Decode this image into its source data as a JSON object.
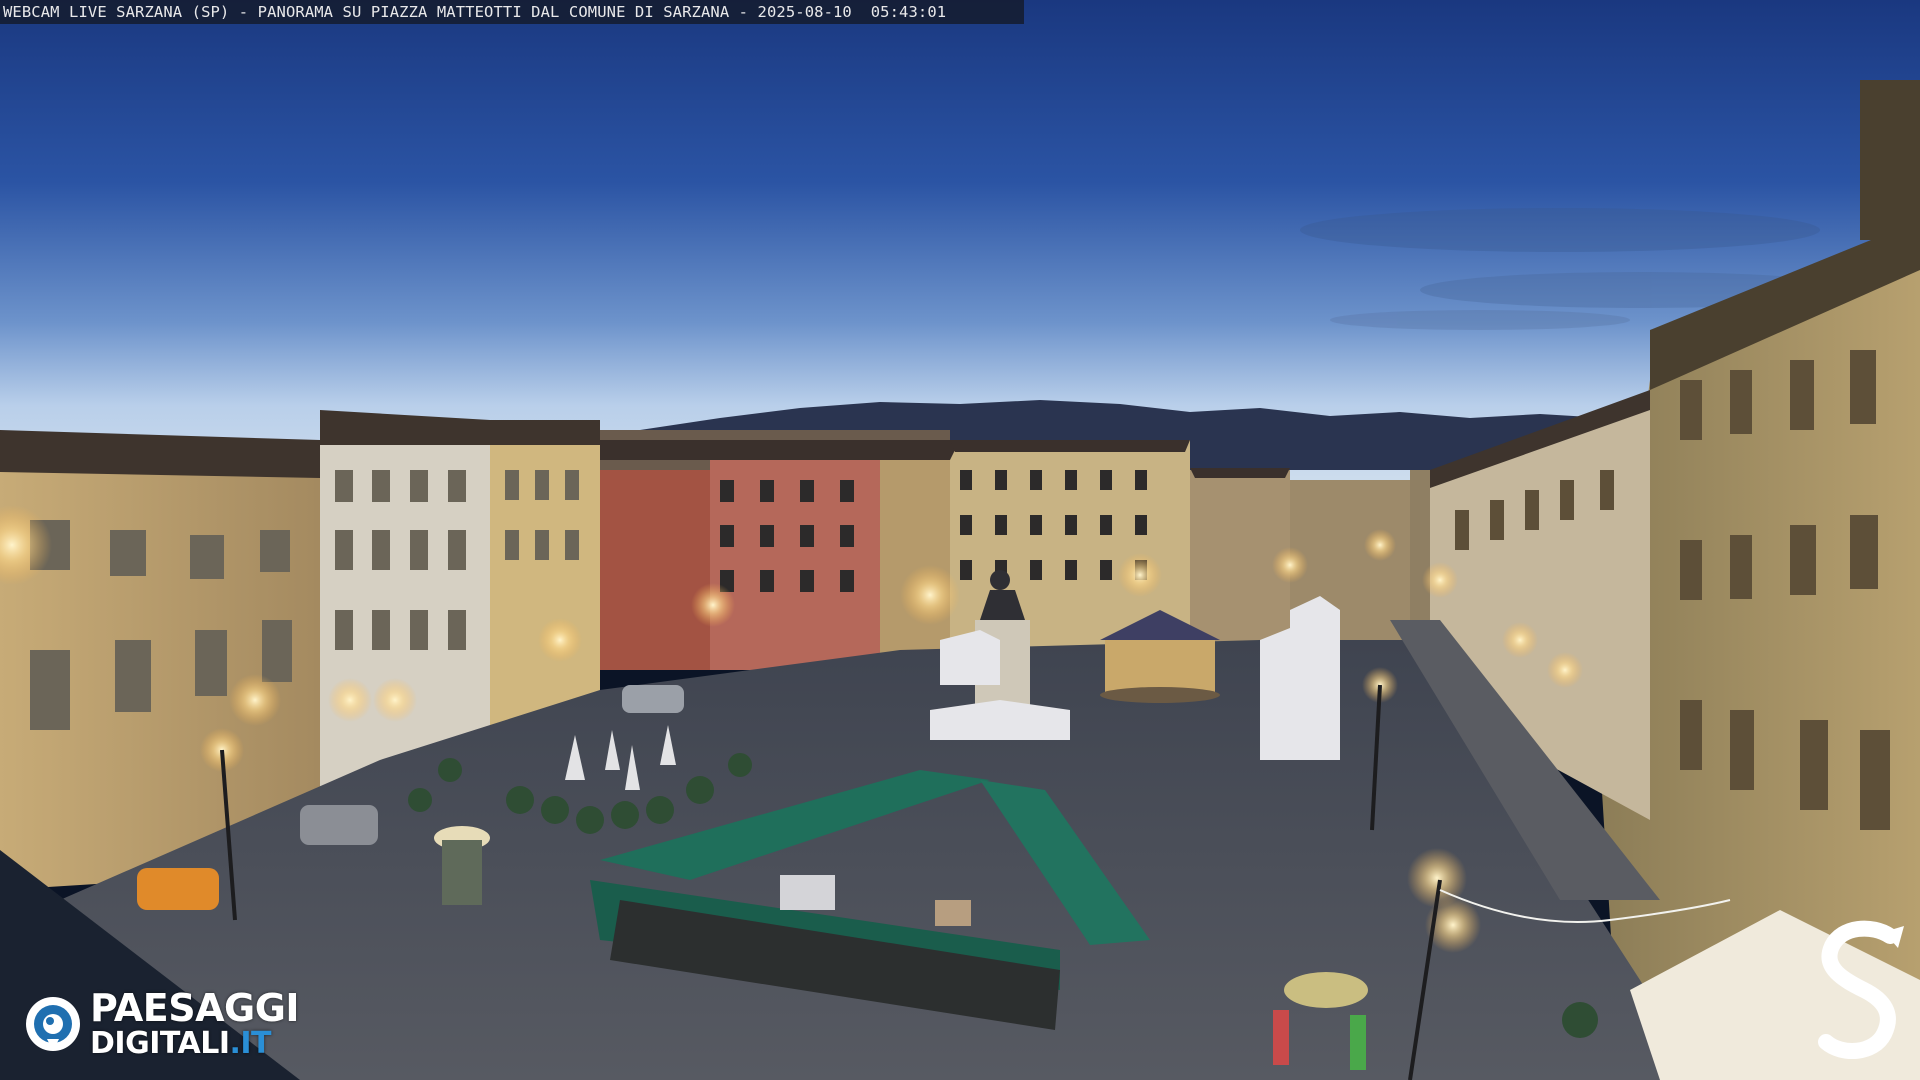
{
  "overlay": {
    "caption": "WEBCAM LIVE SARZANA (SP) - PANORAMA SU PIAZZA MATTEOTTI DAL COMUNE DI SARZANA - 2025-08-10  05:43:01"
  },
  "watermark": {
    "brand_line1": "PAESAGGI",
    "brand_line2_main": "DIGITALI",
    "brand_line2_tld": ".IT",
    "brand_icon": "eye-circle-icon",
    "corner_mark": "S",
    "corner_icon": "stylized-s-logo"
  },
  "colors": {
    "sky_top": "#1d3f86",
    "sky_horizon": "#c9dcef",
    "piazza": "#4d5058",
    "awning_green": "#1f6f5b",
    "brand_blue": "#2a8fd6",
    "lamp_glow": "#ffe2a0"
  }
}
